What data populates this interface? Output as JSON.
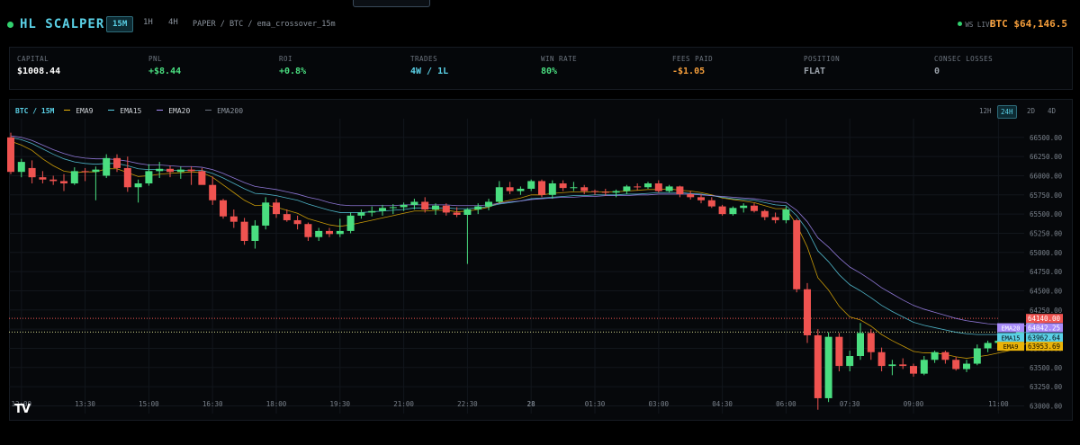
{
  "header": {
    "brand": "HL SCALPER",
    "timeframes": [
      {
        "label": "15M",
        "active": true
      },
      {
        "label": "1H",
        "active": false
      },
      {
        "label": "4H",
        "active": false
      }
    ],
    "breadcrumb": "PAPER / BTC / ema_crossover_15m",
    "ws_status": "WS LIVE",
    "price_label": "BTC $64,146.5"
  },
  "stats": [
    {
      "label": "CAPITAL",
      "value": "$1008.44",
      "color": "#ffffff"
    },
    {
      "label": "PNL",
      "value": "+$8.44",
      "color": "#4ade80"
    },
    {
      "label": "ROI",
      "value": "+0.8%",
      "color": "#4ade80"
    },
    {
      "label": "TRADES",
      "value": "4W / 1L",
      "color": "#5ad0e6"
    },
    {
      "label": "WIN RATE",
      "value": "80%",
      "color": "#4ade80"
    },
    {
      "label": "FEES PAID",
      "value": "-$1.05",
      "color": "#f59e3b"
    },
    {
      "label": "POSITION",
      "value": "FLAT",
      "color": "#9aa1aa"
    },
    {
      "label": "CONSEC LOSSES",
      "value": "0",
      "color": "#9aa1aa"
    }
  ],
  "chart": {
    "pair_label": "BTC / 15M",
    "legend": [
      {
        "name": "EMA9",
        "color": "#eab308"
      },
      {
        "name": "EMA15",
        "color": "#5ad0e6"
      },
      {
        "name": "EMA20",
        "color": "#a78bfa"
      },
      {
        "name": "EMA200",
        "color": "#6b7280"
      }
    ],
    "ranges": [
      {
        "label": "12H",
        "active": false
      },
      {
        "label": "24H",
        "active": true
      },
      {
        "label": "2D",
        "active": false
      },
      {
        "label": "4D",
        "active": false
      }
    ],
    "logo": "TV"
  },
  "chart_data": {
    "type": "candlestick",
    "ylim": [
      62900,
      66650
    ],
    "yticks": [
      66500,
      66250,
      66000,
      65750,
      65500,
      65250,
      65000,
      64750,
      64500,
      64250,
      64000,
      63750,
      63500,
      63250,
      63000
    ],
    "xticks": [
      {
        "label": "12:00",
        "i": 1
      },
      {
        "label": "13:30",
        "i": 7
      },
      {
        "label": "15:00",
        "i": 13
      },
      {
        "label": "16:30",
        "i": 19
      },
      {
        "label": "18:00",
        "i": 25
      },
      {
        "label": "19:30",
        "i": 31
      },
      {
        "label": "21:00",
        "i": 37
      },
      {
        "label": "22:30",
        "i": 43
      },
      {
        "label": "28",
        "i": 49
      },
      {
        "label": "01:30",
        "i": 55
      },
      {
        "label": "03:00",
        "i": 61
      },
      {
        "label": "04:30",
        "i": 67
      },
      {
        "label": "06:00",
        "i": 73
      },
      {
        "label": "07:30",
        "i": 79
      },
      {
        "label": "09:00",
        "i": 85
      },
      {
        "label": "11:00",
        "i": 93
      }
    ],
    "candles": [
      [
        66500,
        66560,
        66020,
        66050
      ],
      [
        66050,
        66220,
        65980,
        66180
      ],
      [
        66100,
        66200,
        65900,
        65980
      ],
      [
        65980,
        66060,
        65900,
        65950
      ],
      [
        65950,
        66000,
        65880,
        65930
      ],
      [
        65930,
        66020,
        65800,
        65900
      ],
      [
        65900,
        66110,
        65880,
        66060
      ],
      [
        66060,
        66100,
        65930,
        66050
      ],
      [
        66050,
        66120,
        65680,
        66080
      ],
      [
        66000,
        66280,
        65970,
        66230
      ],
      [
        66230,
        66280,
        66050,
        66100
      ],
      [
        66100,
        66250,
        65790,
        65850
      ],
      [
        65850,
        65950,
        65650,
        65900
      ],
      [
        65900,
        66150,
        65870,
        66060
      ],
      [
        66060,
        66180,
        65970,
        66090
      ],
      [
        66090,
        66130,
        65980,
        66050
      ],
      [
        66050,
        66120,
        65960,
        66080
      ],
      [
        66080,
        66120,
        65880,
        66060
      ],
      [
        66060,
        66100,
        65940,
        65880
      ],
      [
        65880,
        65990,
        65620,
        65680
      ],
      [
        65680,
        65700,
        65440,
        65470
      ],
      [
        65470,
        65560,
        65320,
        65400
      ],
      [
        65400,
        65450,
        65100,
        65150
      ],
      [
        65150,
        65420,
        65050,
        65350
      ],
      [
        65350,
        65720,
        65300,
        65650
      ],
      [
        65650,
        65700,
        65450,
        65500
      ],
      [
        65500,
        65560,
        65400,
        65420
      ],
      [
        65420,
        65480,
        65300,
        65370
      ],
      [
        65370,
        65390,
        65150,
        65200
      ],
      [
        65200,
        65320,
        65150,
        65280
      ],
      [
        65280,
        65320,
        65200,
        65240
      ],
      [
        65240,
        65440,
        65200,
        65280
      ],
      [
        65280,
        65520,
        65250,
        65480
      ],
      [
        65480,
        65560,
        65440,
        65520
      ],
      [
        65520,
        65600,
        65470,
        65540
      ],
      [
        65540,
        65620,
        65480,
        65580
      ],
      [
        65580,
        65630,
        65500,
        65590
      ],
      [
        65590,
        65650,
        65540,
        65620
      ],
      [
        65620,
        65700,
        65560,
        65660
      ],
      [
        65660,
        65720,
        65520,
        65560
      ],
      [
        65560,
        65640,
        65490,
        65610
      ],
      [
        65610,
        65640,
        65480,
        65520
      ],
      [
        65520,
        65590,
        65460,
        65490
      ],
      [
        65490,
        65580,
        64850,
        65560
      ],
      [
        65560,
        65640,
        65500,
        65600
      ],
      [
        65600,
        65700,
        65550,
        65660
      ],
      [
        65660,
        65930,
        65640,
        65850
      ],
      [
        65850,
        65920,
        65760,
        65800
      ],
      [
        65800,
        65860,
        65750,
        65830
      ],
      [
        65830,
        65950,
        65800,
        65930
      ],
      [
        65930,
        65950,
        65720,
        65750
      ],
      [
        65750,
        65940,
        65700,
        65900
      ],
      [
        65900,
        65940,
        65800,
        65840
      ],
      [
        65840,
        65920,
        65800,
        65850
      ],
      [
        65850,
        65880,
        65760,
        65800
      ],
      [
        65800,
        65820,
        65750,
        65790
      ],
      [
        65790,
        65830,
        65740,
        65780
      ],
      [
        65780,
        65820,
        65720,
        65800
      ],
      [
        65800,
        65880,
        65760,
        65860
      ],
      [
        65860,
        65900,
        65810,
        65850
      ],
      [
        65850,
        65920,
        65830,
        65900
      ],
      [
        65900,
        65940,
        65780,
        65800
      ],
      [
        65800,
        65880,
        65780,
        65860
      ],
      [
        65860,
        65870,
        65720,
        65760
      ],
      [
        65760,
        65800,
        65690,
        65720
      ],
      [
        65720,
        65760,
        65640,
        65680
      ],
      [
        65680,
        65720,
        65580,
        65600
      ],
      [
        65600,
        65620,
        65480,
        65500
      ],
      [
        65500,
        65600,
        65480,
        65580
      ],
      [
        65580,
        65640,
        65520,
        65610
      ],
      [
        65610,
        65640,
        65520,
        65540
      ],
      [
        65540,
        65560,
        65420,
        65460
      ],
      [
        65460,
        65520,
        65380,
        65420
      ],
      [
        65420,
        65600,
        65380,
        65560
      ],
      [
        65420,
        65440,
        64480,
        64520
      ],
      [
        64520,
        64600,
        63820,
        63920
      ],
      [
        63920,
        64000,
        62950,
        63100
      ],
      [
        63100,
        63960,
        63050,
        63900
      ],
      [
        63900,
        63950,
        63450,
        63520
      ],
      [
        63520,
        63720,
        63450,
        63650
      ],
      [
        63650,
        64080,
        63600,
        63950
      ],
      [
        63950,
        64000,
        63600,
        63700
      ],
      [
        63700,
        63760,
        63450,
        63520
      ],
      [
        63520,
        63600,
        63400,
        63540
      ],
      [
        63540,
        63620,
        63480,
        63520
      ],
      [
        63520,
        63550,
        63380,
        63420
      ],
      [
        63420,
        63650,
        63400,
        63600
      ],
      [
        63600,
        63720,
        63560,
        63700
      ],
      [
        63700,
        63720,
        63550,
        63600
      ],
      [
        63600,
        63640,
        63460,
        63480
      ],
      [
        63480,
        63600,
        63440,
        63550
      ],
      [
        63550,
        63800,
        63530,
        63750
      ],
      [
        63750,
        63850,
        63700,
        63820
      ],
      [
        63820,
        63880,
        63780,
        63850
      ],
      [
        63850,
        63920,
        63820,
        63900
      ],
      [
        63900,
        64080,
        63880,
        64050
      ],
      [
        64050,
        64150,
        64000,
        64140
      ],
      [
        64140,
        64160,
        64050,
        64080
      ]
    ],
    "ema": {
      "EMA9": [
        66450,
        66400,
        66330,
        66220,
        66130,
        66060,
        66040,
        66050,
        66050,
        66090,
        66090,
        66040,
        65990,
        66000,
        66020,
        66030,
        66040,
        66050,
        66040,
        65980,
        65880,
        65780,
        65680,
        65610,
        65620,
        65590,
        65550,
        65510,
        65440,
        65400,
        65360,
        65340,
        65360,
        65390,
        65420,
        65450,
        65480,
        65510,
        65540,
        65540,
        65550,
        65550,
        65530,
        65540,
        65560,
        65590,
        65650,
        65680,
        65710,
        65750,
        65750,
        65770,
        65780,
        65790,
        65790,
        65790,
        65790,
        65790,
        65800,
        65810,
        65820,
        65820,
        65830,
        65810,
        65800,
        65780,
        65750,
        65710,
        65690,
        65670,
        65650,
        65610,
        65570,
        65570,
        65360,
        65070,
        64670,
        64510,
        64300,
        64160,
        64120,
        64040,
        63930,
        63850,
        63780,
        63710,
        63690,
        63690,
        63670,
        63640,
        63620,
        63640,
        63660,
        63690,
        63720,
        63780,
        63830
      ],
      "EMA15": [
        66500,
        66470,
        66420,
        66350,
        66280,
        66220,
        66180,
        66160,
        66150,
        66160,
        66160,
        66130,
        66090,
        66080,
        66080,
        66070,
        66070,
        66070,
        66070,
        66030,
        65970,
        65900,
        65830,
        65770,
        65760,
        65740,
        65710,
        65680,
        65630,
        65590,
        65550,
        65520,
        65520,
        65520,
        65530,
        65540,
        65550,
        65560,
        65580,
        65580,
        65580,
        65580,
        65570,
        65570,
        65580,
        65600,
        65630,
        65650,
        65670,
        65700,
        65710,
        65720,
        65730,
        65740,
        65740,
        65750,
        65750,
        65750,
        65760,
        65760,
        65770,
        65780,
        65780,
        65780,
        65770,
        65760,
        65740,
        65720,
        65700,
        65690,
        65680,
        65650,
        65620,
        65610,
        65480,
        65290,
        65020,
        64880,
        64710,
        64580,
        64500,
        64410,
        64310,
        64230,
        64160,
        64090,
        64050,
        64020,
        63990,
        63960,
        63940,
        63930,
        63930,
        63930,
        63940,
        63950,
        63962
      ],
      "EMA20": [
        66520,
        66500,
        66460,
        66400,
        66340,
        66290,
        66250,
        66230,
        66220,
        66220,
        66210,
        66190,
        66160,
        66140,
        66140,
        66130,
        66120,
        66120,
        66110,
        66080,
        66030,
        65970,
        65910,
        65860,
        65840,
        65820,
        65790,
        65760,
        65720,
        65690,
        65650,
        65620,
        65610,
        65610,
        65610,
        65610,
        65610,
        65620,
        65620,
        65620,
        65620,
        65620,
        65610,
        65610,
        65610,
        65620,
        65640,
        65660,
        65670,
        65690,
        65700,
        65710,
        65720,
        65720,
        65730,
        65730,
        65740,
        65740,
        65740,
        65750,
        65750,
        65760,
        65760,
        65760,
        65760,
        65750,
        65740,
        65730,
        65720,
        65710,
        65700,
        65680,
        65660,
        65650,
        65550,
        65400,
        65190,
        65070,
        64930,
        64810,
        64730,
        64640,
        64540,
        64460,
        64380,
        64310,
        64260,
        64220,
        64180,
        64140,
        64110,
        64090,
        64070,
        64060,
        64050,
        64045,
        64042
      ]
    },
    "price_lines": [
      {
        "label": "64140.00",
        "value": 64140,
        "color": "#ef5350",
        "style": "dotted"
      },
      {
        "label": "EMA20",
        "value2": "64042.25",
        "value": 64042,
        "color": "#a78bfa"
      },
      {
        "label": "EMA15",
        "value2": "63962.64",
        "value": 63962,
        "color": "#5ad0e6"
      },
      {
        "label": "EMA9",
        "value2": "63953.69",
        "value": 63953,
        "color": "#eab308"
      }
    ]
  }
}
